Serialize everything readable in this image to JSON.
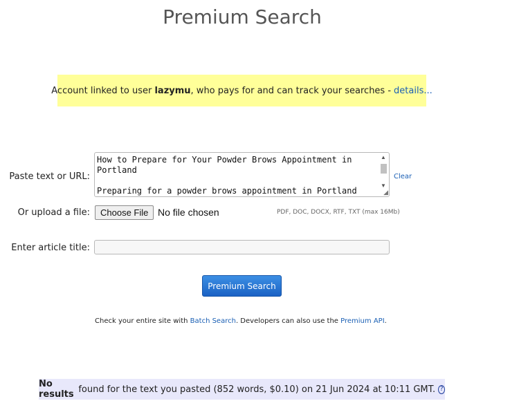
{
  "page": {
    "title": "Premium Search"
  },
  "account": {
    "prefix": "Account linked to user ",
    "user": "lazymu",
    "suffix": ", who pays for and can track your searches -",
    "details_link": "details..."
  },
  "form": {
    "paste_label": "Paste text or URL:",
    "paste_value": "How to Prepare for Your Powder Brows Appointment in\nPortland\n\nPreparing for a powder brows appointment in Portland",
    "clear_link": "Clear",
    "upload_label": "Or upload a file:",
    "choose_file_label": "Choose File",
    "no_file_text": "No file chosen",
    "file_types": "PDF, DOC, DOCX, RTF, TXT (max 16Mb)",
    "title_label": "Enter article title:",
    "title_value": "",
    "search_button": "Premium Search"
  },
  "help": {
    "prefix": "Check your entire site with ",
    "batch_link": "Batch Search",
    "middle": ". Developers can also use the ",
    "api_link": "Premium API",
    "suffix": "."
  },
  "results": {
    "bold": "No results",
    "text": " found for the text you pasted (852 words, $0.10) on 21 Jun 2024 at 10:11 GMT.",
    "help_icon": "?"
  }
}
